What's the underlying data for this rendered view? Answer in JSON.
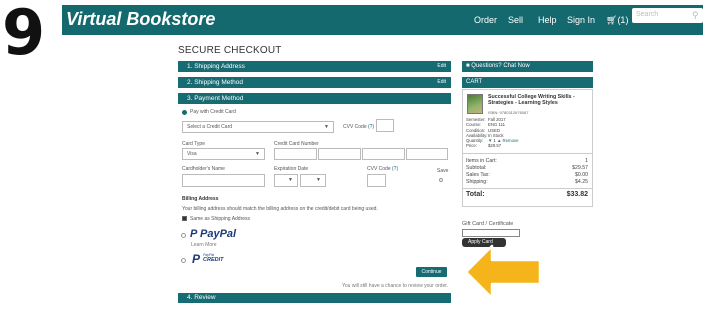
{
  "step_number": "9",
  "header": {
    "brand": "Virtual Bookstore",
    "nav": [
      "Order",
      "Sell",
      "Help",
      "Sign In"
    ],
    "cart_label": "(1)",
    "search_placeholder": "Search"
  },
  "checkout": {
    "title": "SECURE CHECKOUT",
    "sections": {
      "shipping_address": "1. Shipping Address",
      "shipping_method": "2. Shipping Method",
      "payment_method": "3. Payment Method",
      "review": "4. Review",
      "edit": "Edit"
    },
    "payment": {
      "pay_with_card": "Pay with Credit Card",
      "select_card": "Select a Credit Card",
      "cvv_label": "CVV Code",
      "cvv_help": "(?)",
      "card_type_label": "Card Type",
      "card_type_value": "Visa",
      "card_number_label": "Credit Card Number",
      "cardholder_label": "Cardholder's Name",
      "expiration_label": "Expiration Date",
      "cvv2_label": "CVV Code",
      "save_label": "Save",
      "billing_title": "Billing Address",
      "billing_note": "Your billing address should match the billing address on the credit/debit card being used.",
      "same_as_shipping": "Same as Shipping Address",
      "paypal_label": "PayPal",
      "paypal_learn_more": "Learn More",
      "paypal_credit_top": "PayPal",
      "paypal_credit_label": "CREDIT",
      "continue_label": "Continue",
      "review_note": "You will still have a chance to review your order."
    }
  },
  "sidebar": {
    "questions": "Questions? Chat Now",
    "cart_title": "CART",
    "book_title": "Successful College Writing Skills - Strategies - Learning Styles",
    "book_isbn": "ISBN: 9780312676087",
    "details": [
      {
        "k": "Semester:",
        "v": "Fall 2017"
      },
      {
        "k": "Course:",
        "v": "ENG 111"
      },
      {
        "k": "Condition:",
        "v": "USED"
      },
      {
        "k": "Availability:",
        "v": "In Stock"
      },
      {
        "k": "Quantity:",
        "v": "1"
      },
      {
        "k": "Price:",
        "v": "$29.57"
      }
    ],
    "remove_label": "Remove",
    "summary": [
      {
        "k": "Items in Cart:",
        "v": "1"
      },
      {
        "k": "Subtotal:",
        "v": "$29.57"
      },
      {
        "k": "Sales Tax:",
        "v": "$0.00"
      },
      {
        "k": "Shipping:",
        "v": "$4.25"
      }
    ],
    "total_label": "Total:",
    "total_value": "$33.82",
    "gift_label": "Gift Card / Certificate",
    "apply_label": "Apply Card"
  },
  "colors": {
    "teal": "#176b72",
    "arrow": "#f5b51a"
  }
}
